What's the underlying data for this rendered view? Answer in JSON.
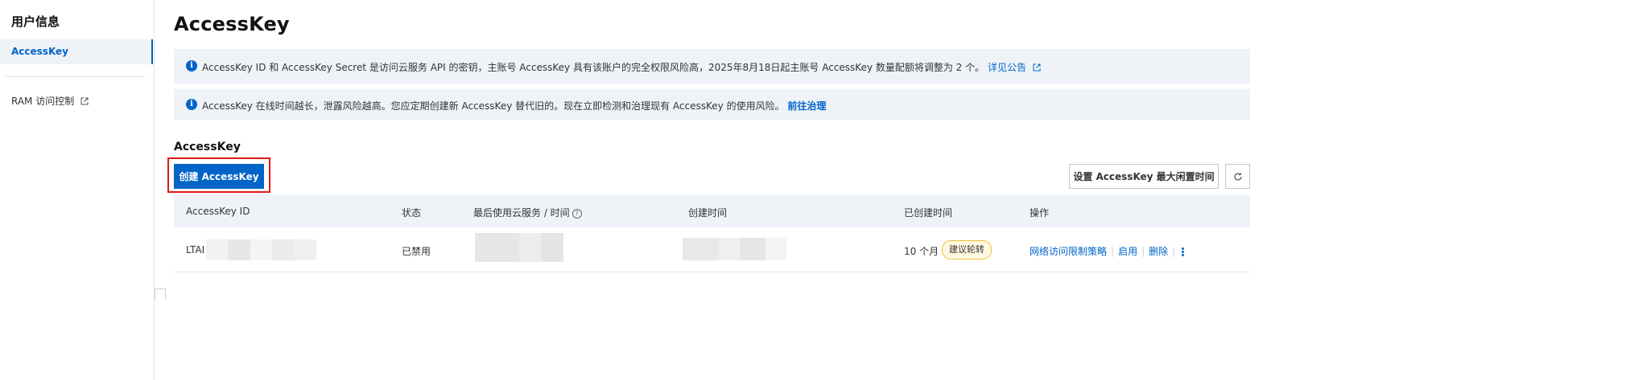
{
  "sidebar": {
    "title": "用户信息",
    "active_item": "AccessKey",
    "link_item": "RAM 访问控制"
  },
  "page": {
    "title": "AccessKey"
  },
  "notices": [
    {
      "text": "AccessKey ID 和 AccessKey Secret 是访问云服务 API 的密钥，主账号 AccessKey 具有该账户的完全权限风险高，2025年8月18日起主账号 AccessKey 数量配额将调整为 2 个。",
      "link": "详见公告"
    },
    {
      "text": "AccessKey 在线时间越长，泄露风险越高。您应定期创建新 AccessKey 替代旧的。现在立即检测和治理现有 AccessKey 的使用风险。",
      "link": "前往治理"
    }
  ],
  "section": {
    "title": "AccessKey",
    "create_label": "创建 AccessKey",
    "idle_label": "设置 AccessKey 最大闲置时间"
  },
  "table": {
    "headers": [
      "AccessKey ID",
      "状态",
      "最后使用云服务 / 时间",
      "创建时间",
      "已创建时间",
      "操作"
    ],
    "rows": [
      {
        "id_prefix": "LTAI",
        "status": "已禁用",
        "age": "10 个月",
        "badge": "建议轮转",
        "actions": [
          "网络访问限制策略",
          "启用",
          "删除"
        ]
      }
    ]
  },
  "icons": {
    "info": "info-icon",
    "external": "external-link-icon",
    "help": "help-circle-icon",
    "refresh": "refresh-icon",
    "more": "more-vertical-icon"
  },
  "colors": {
    "primary": "#0064c8",
    "highlight_border": "#e0191b",
    "notice_bg": "#eff3f8",
    "badge_border": "#f0c040"
  }
}
